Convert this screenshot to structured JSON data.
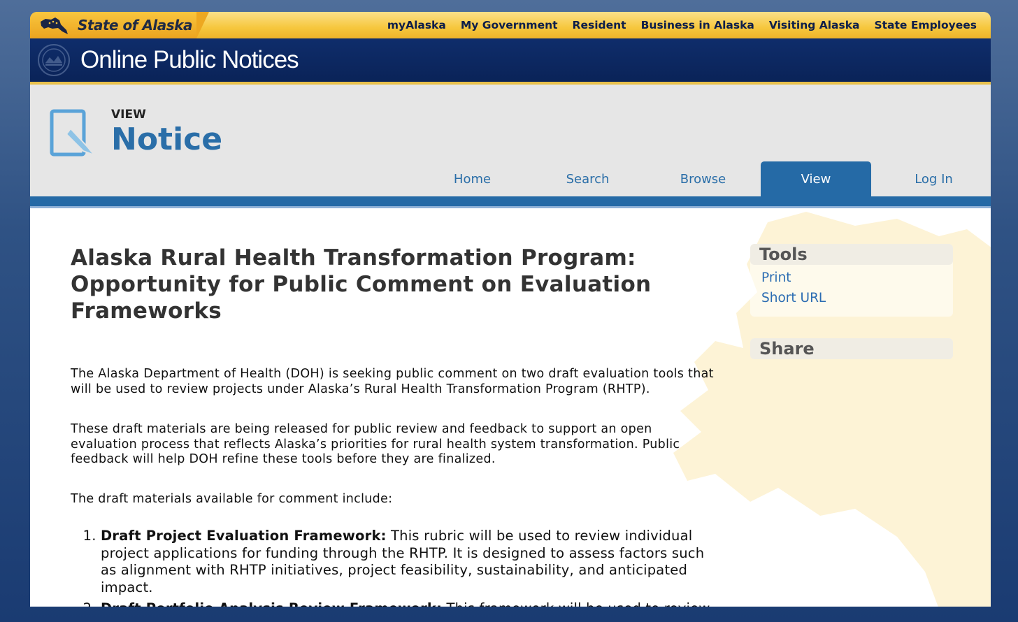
{
  "brand": {
    "label": "State of Alaska"
  },
  "topnav": [
    "myAlaska",
    "My Government",
    "Resident",
    "Business in Alaska",
    "Visiting Alaska",
    "State Employees"
  ],
  "banner": {
    "title": "Online Public Notices"
  },
  "header": {
    "subtitle": "VIEW",
    "title": "Notice"
  },
  "tabs": [
    {
      "label": "Home",
      "active": false
    },
    {
      "label": "Search",
      "active": false
    },
    {
      "label": "Browse",
      "active": false
    },
    {
      "label": "View",
      "active": true
    },
    {
      "label": "Log In",
      "active": false
    }
  ],
  "notice": {
    "title": "Alaska Rural Health Transformation Program: Opportunity for Public Comment on Evaluation Frameworks",
    "paragraphs": [
      "The Alaska Department of Health (DOH) is seeking public comment on two draft evaluation tools that will be used to review projects under Alaska’s Rural Health Transformation Program (RHTP).",
      "These draft materials are being released for public review and feedback to support an open evaluation process that reflects Alaska’s priorities for rural health system transformation. Public feedback will help DOH refine these tools before they are finalized.",
      "The draft materials available for comment include:"
    ],
    "list": [
      {
        "bold": "Draft Project Evaluation Framework:",
        "text": " This rubric will be used to review individual project applications for funding through the RHTP. It is designed to assess factors such as alignment with RHTP initiatives, project feasibility, sustainability, and anticipated impact."
      },
      {
        "bold": "Draft Portfolio Analysis Review Framework:",
        "text": " This framework will be used to review the"
      }
    ]
  },
  "sidebar": {
    "tools": {
      "title": "Tools",
      "links": [
        "Print",
        "Short URL"
      ]
    },
    "share": {
      "title": "Share"
    }
  },
  "colors": {
    "accent_blue": "#256aa6",
    "link_blue": "#2b6cb2",
    "banner_navy": "#0f2d6b",
    "topbar_gold": "#f6c73d"
  }
}
